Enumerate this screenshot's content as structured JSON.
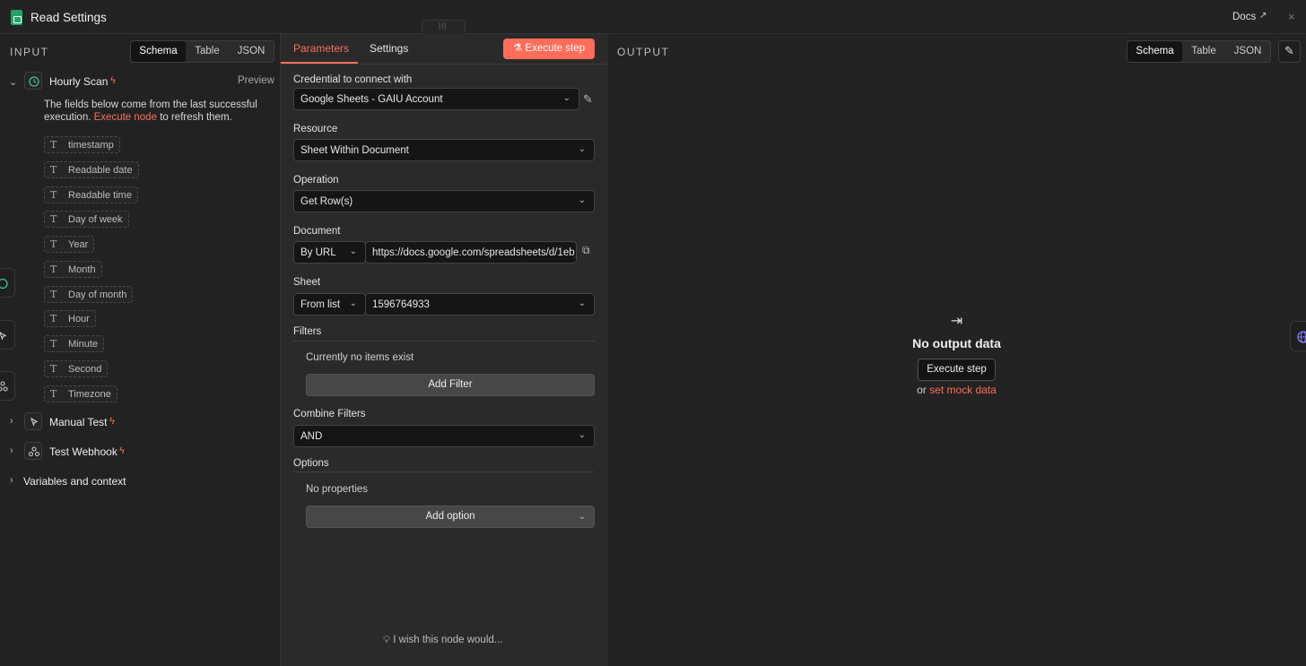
{
  "window": {
    "title": "Read Settings",
    "docs_label": "Docs",
    "close_label": "×"
  },
  "input": {
    "label": "INPUT",
    "view_tabs": [
      "Schema",
      "Table",
      "JSON"
    ],
    "active_tab": "Schema",
    "hourly_scan": {
      "name": "Hourly Scan",
      "preview_label": "Preview",
      "info_line1": "The fields below come from the last successful",
      "info_pre": "execution.",
      "info_link": "Execute node",
      "info_post": "to refresh them.",
      "fields": [
        "timestamp",
        "Readable date",
        "Readable time",
        "Day of week",
        "Year",
        "Month",
        "Day of month",
        "Hour",
        "Minute",
        "Second",
        "Timezone"
      ]
    },
    "manual_test": "Manual Test",
    "test_webhook": "Test Webhook",
    "variables": "Variables and context"
  },
  "params": {
    "tabs": [
      "Parameters",
      "Settings"
    ],
    "execute_label": "Execute step",
    "credential_label": "Credential to connect with",
    "credential_value": "Google Sheets - GAIU Account",
    "resource_label": "Resource",
    "resource_value": "Sheet Within Document",
    "operation_label": "Operation",
    "operation_value": "Get Row(s)",
    "document_label": "Document",
    "document_mode": "By URL",
    "document_url": "https://docs.google.com/spreadsheets/d/1eb_",
    "sheet_label": "Sheet",
    "sheet_mode": "From list",
    "sheet_value": "1596764933",
    "filters_label": "Filters",
    "filters_empty": "Currently no items exist",
    "add_filter": "Add Filter",
    "combine_label": "Combine Filters",
    "combine_value": "AND",
    "options_label": "Options",
    "options_empty": "No properties",
    "add_option": "Add option",
    "wish": "I wish this node would..."
  },
  "output": {
    "label": "OUTPUT",
    "view_tabs": [
      "Schema",
      "Table",
      "JSON"
    ],
    "active_tab": "Schema",
    "empty_title": "No output data",
    "execute_label": "Execute step",
    "or_label": "or",
    "mock_link": "set mock data"
  },
  "colors": {
    "accent": "#ff6d5a",
    "sheets_green": "#21a366"
  }
}
